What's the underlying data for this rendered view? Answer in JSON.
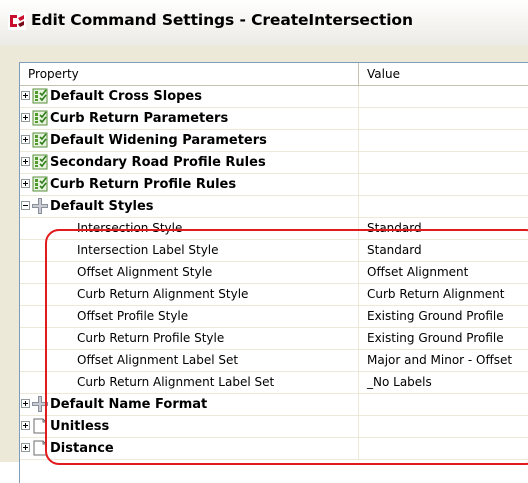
{
  "window": {
    "title": "Edit Command Settings - CreateIntersection"
  },
  "grid": {
    "header": {
      "property": "Property",
      "value": "Value"
    },
    "rows": [
      {
        "kind": "category",
        "label": "Default Cross Slopes",
        "icon": "checklist-icon",
        "expander": "plus",
        "value": ""
      },
      {
        "kind": "category",
        "label": "Curb Return Parameters",
        "icon": "checklist-icon",
        "expander": "plus",
        "value": ""
      },
      {
        "kind": "category",
        "label": "Default Widening Parameters",
        "icon": "checklist-icon",
        "expander": "plus",
        "value": ""
      },
      {
        "kind": "category",
        "label": "Secondary Road Profile Rules",
        "icon": "checklist-icon",
        "expander": "plus",
        "value": ""
      },
      {
        "kind": "category",
        "label": "Curb Return Profile Rules",
        "icon": "checklist-icon",
        "expander": "plus",
        "value": ""
      },
      {
        "kind": "category",
        "label": "Default Styles",
        "icon": "styles-icon",
        "expander": "minus",
        "value": ""
      },
      {
        "kind": "child",
        "label": "Intersection Style",
        "value": "Standard"
      },
      {
        "kind": "child",
        "label": "Intersection Label Style",
        "value": "Standard"
      },
      {
        "kind": "child",
        "label": "Offset Alignment Style",
        "value": "Offset Alignment"
      },
      {
        "kind": "child",
        "label": "Curb Return Alignment Style",
        "value": "Curb Return Alignment"
      },
      {
        "kind": "child",
        "label": "Offset Profile Style",
        "value": "Existing Ground Profile"
      },
      {
        "kind": "child",
        "label": "Curb Return Profile Style",
        "value": "Existing Ground Profile"
      },
      {
        "kind": "child",
        "label": "Offset Alignment Label Set",
        "value": "Major and Minor - Offset"
      },
      {
        "kind": "child",
        "label": "Curb Return Alignment Label Set",
        "value": "_No Labels"
      },
      {
        "kind": "category",
        "label": "Default Name Format",
        "icon": "styles-icon",
        "expander": "plus",
        "value": ""
      },
      {
        "kind": "category",
        "label": "Unitless",
        "icon": "document-icon",
        "expander": "plus",
        "value": ""
      },
      {
        "kind": "category",
        "label": "Distance",
        "icon": "document-icon",
        "expander": "plus",
        "value": ""
      }
    ]
  },
  "colors": {
    "highlight": "#e31a1c",
    "grid_line": "#ece9d8",
    "frame": "#ece9d8"
  }
}
